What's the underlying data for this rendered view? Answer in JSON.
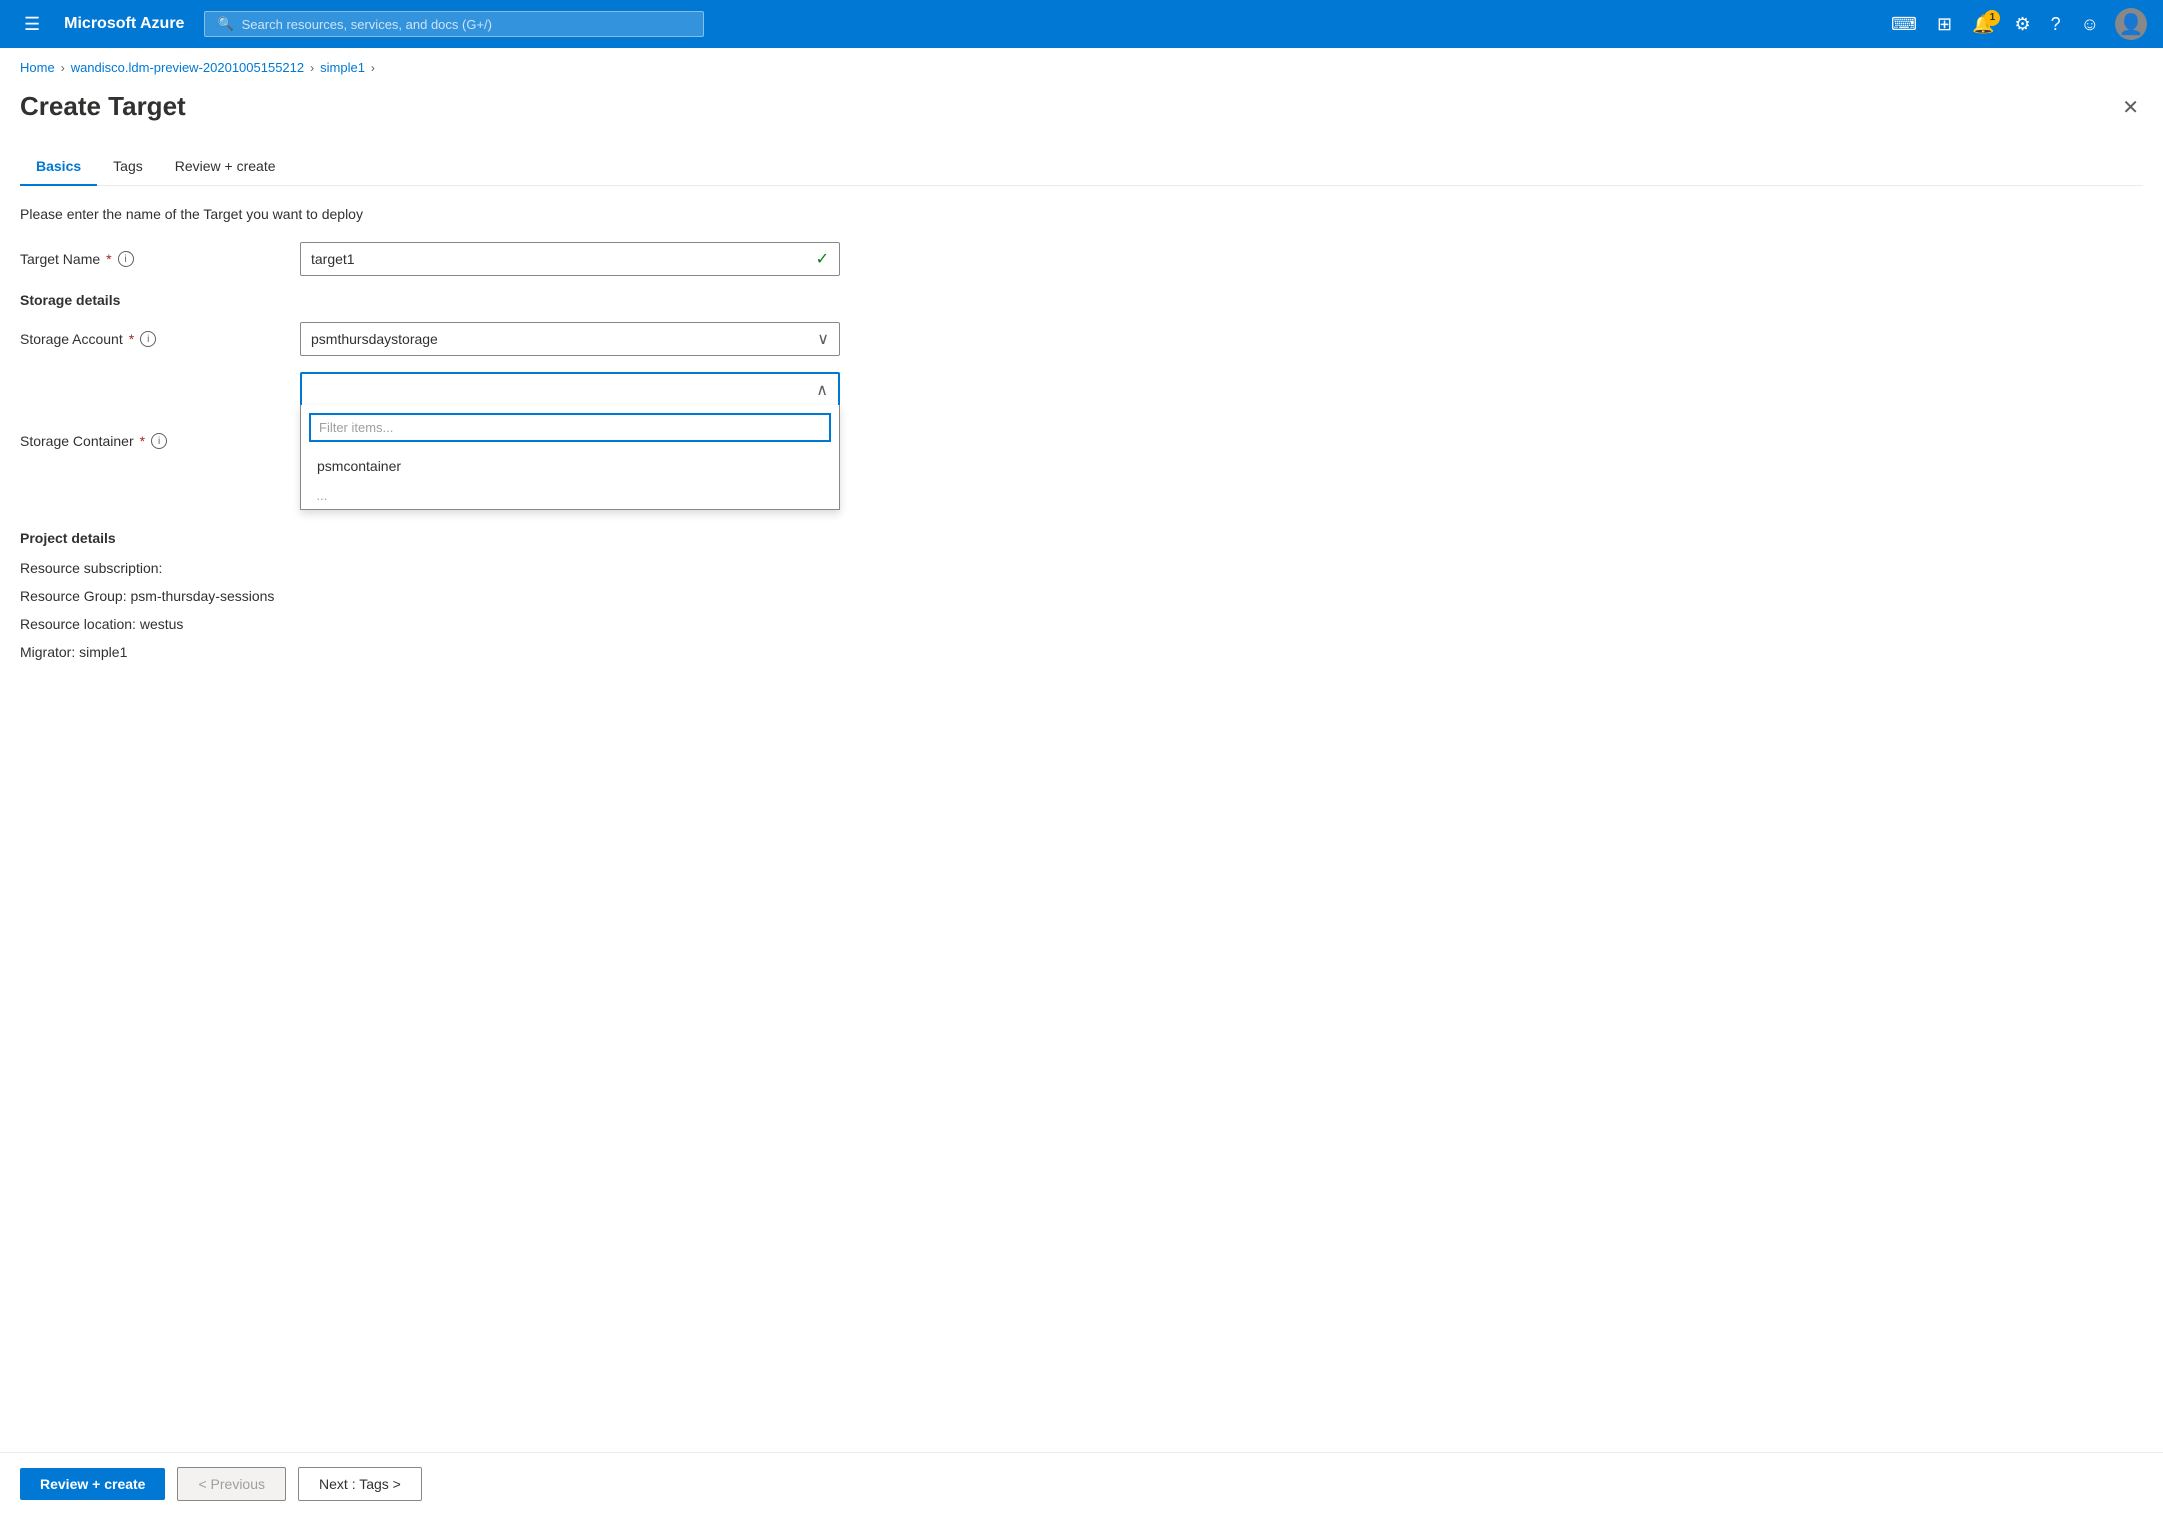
{
  "topnav": {
    "brand": "Microsoft Azure",
    "search_placeholder": "Search resources, services, and docs (G+/)",
    "notification_count": "1"
  },
  "breadcrumb": {
    "items": [
      "Home",
      "wandisco.ldm-preview-20201005155212",
      "simple1"
    ]
  },
  "page": {
    "title": "Create Target",
    "subtitle": "Please enter the name of the Target you want to deploy"
  },
  "tabs": [
    {
      "label": "Basics",
      "active": true
    },
    {
      "label": "Tags",
      "active": false
    },
    {
      "label": "Review + create",
      "active": false
    }
  ],
  "form": {
    "target_name_label": "Target Name",
    "target_name_value": "target1",
    "storage_details_heading": "Storage details",
    "storage_account_label": "Storage Account",
    "storage_account_value": "psmthursdaystorage",
    "storage_container_label": "Storage Container",
    "storage_container_value": "",
    "filter_placeholder": "Filter items...",
    "dropdown_items": [
      "psmcontainer"
    ],
    "dropdown_truncated": "...",
    "project_details_heading": "Project details",
    "resource_subscription_label": "Resource subscription:",
    "resource_subscription_value": "",
    "resource_group_label": "Resource Group: psm-thursday-sessions",
    "resource_location_label": "Resource location: westus",
    "migrator_label": "Migrator: simple1"
  },
  "footer": {
    "review_create_label": "Review + create",
    "previous_label": "< Previous",
    "next_label": "Next : Tags >"
  }
}
